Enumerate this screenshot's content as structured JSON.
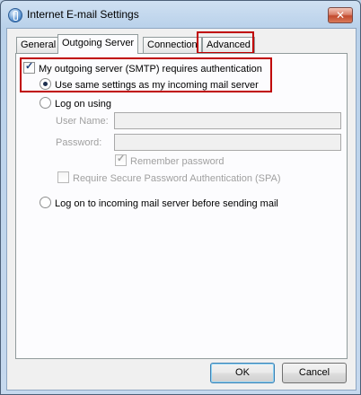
{
  "window": {
    "title": "Internet E-mail Settings",
    "close_label": "✕"
  },
  "tabs": [
    {
      "label": "General"
    },
    {
      "label": "Outgoing Server"
    },
    {
      "label": "Connection"
    },
    {
      "label": "Advanced"
    }
  ],
  "outgoing": {
    "smtp_auth_label": "My outgoing server (SMTP) requires authentication",
    "smtp_auth_checked": true,
    "use_same_label": "Use same settings as my incoming mail server",
    "logon_using_label": "Log on using",
    "username_label": "User Name:",
    "username_value": "",
    "password_label": "Password:",
    "password_value": "",
    "remember_label": "Remember password",
    "spa_label": "Require Secure Password Authentication (SPA)",
    "logon_incoming_label": "Log on to incoming mail server before sending mail"
  },
  "buttons": {
    "ok": "OK",
    "cancel": "Cancel"
  },
  "colors": {
    "highlight": "#c00000"
  }
}
